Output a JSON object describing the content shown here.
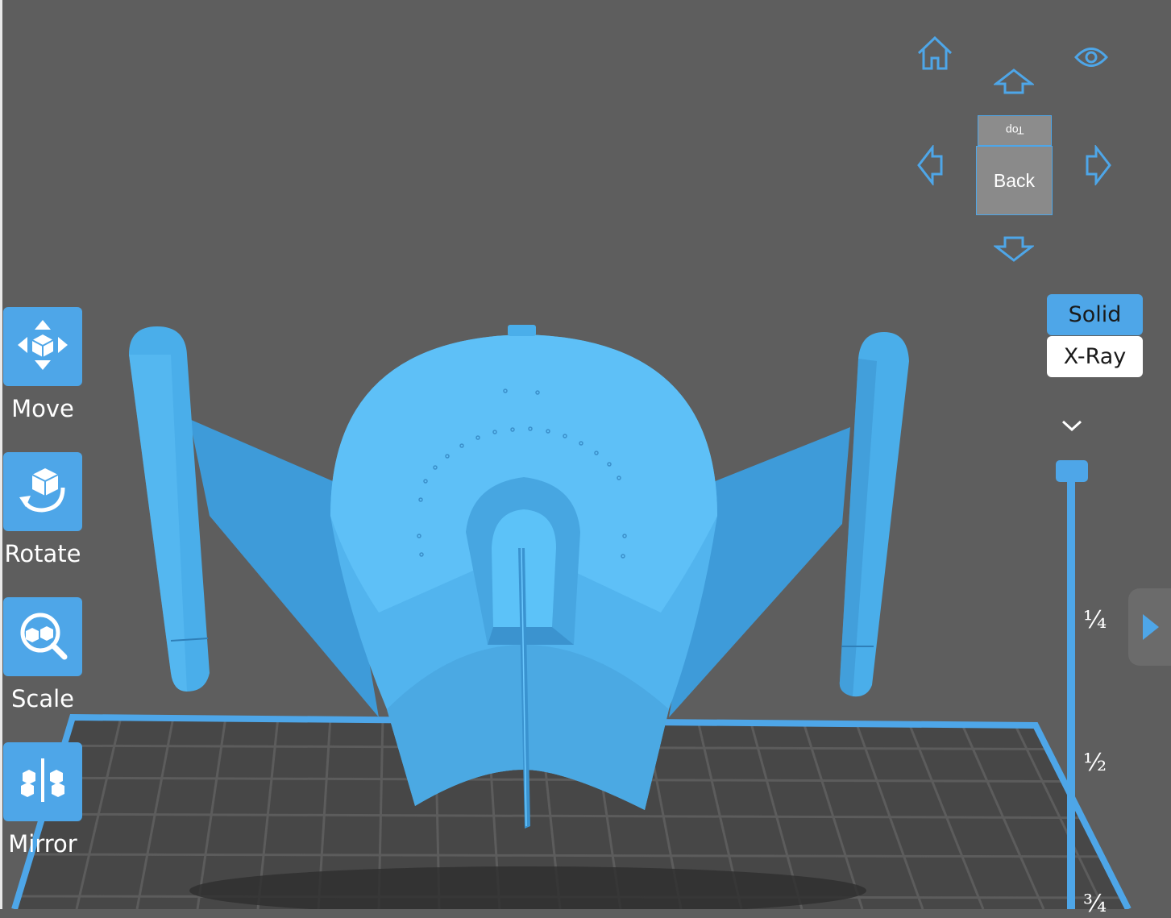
{
  "toolbar": {
    "move_label": "Move",
    "rotate_label": "Rotate",
    "scale_label": "Scale",
    "mirror_label": "Mirror"
  },
  "nav": {
    "cube_top_label": "Top",
    "cube_front_label": "Back"
  },
  "render_mode": {
    "solid_label": "Solid",
    "xray_label": "X-Ray",
    "selected": "Solid"
  },
  "layer_slider": {
    "tick_quarter": "¼",
    "tick_half": "½",
    "tick_three_quarter": "¾"
  },
  "icons": [
    "home-icon",
    "eye-icon",
    "arrow-up-icon",
    "arrow-left-icon",
    "arrow-right-icon",
    "arrow-down-icon",
    "chevron-down-icon",
    "move-icon",
    "rotate-icon",
    "scale-icon",
    "mirror-icon",
    "triangle-right-icon"
  ],
  "colors": {
    "background": "#5e5e5e",
    "accent": "#4ea6e8",
    "model": "#4aaeea",
    "grid": "#3a3a3a"
  }
}
